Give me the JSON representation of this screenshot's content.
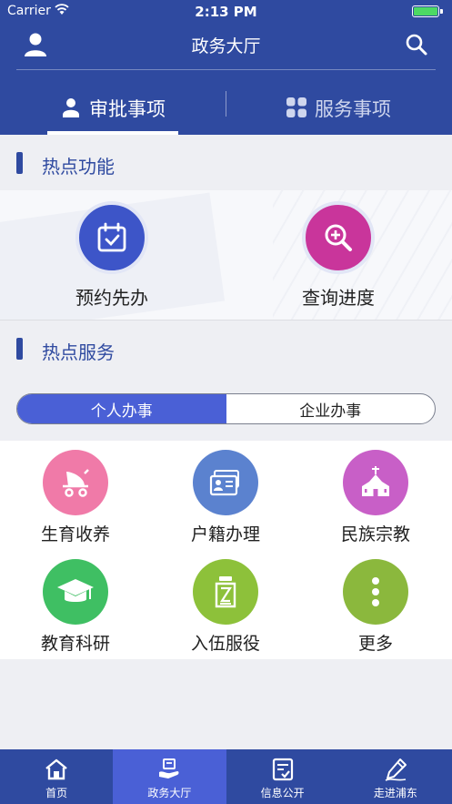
{
  "status_bar": {
    "carrier": "Carrier",
    "time": "2:13 PM"
  },
  "nav": {
    "title": "政务大厅"
  },
  "top_tabs": [
    {
      "label": "审批事项",
      "active": true
    },
    {
      "label": "服务事项",
      "active": false
    }
  ],
  "hot_functions": {
    "title": "热点功能",
    "items": [
      {
        "label": "预约先办",
        "icon": "calendar-check-icon",
        "color": "#3d55c8"
      },
      {
        "label": "查询进度",
        "icon": "magnify-plus-icon",
        "color": "#c9359b"
      }
    ]
  },
  "hot_services": {
    "title": "热点服务",
    "segments": [
      {
        "label": "个人办事",
        "active": true
      },
      {
        "label": "企业办事",
        "active": false
      }
    ],
    "items": [
      {
        "label": "生育收养",
        "icon": "stroller-icon",
        "color": "#f07aa8"
      },
      {
        "label": "户籍办理",
        "icon": "id-card-icon",
        "color": "#5b82cf"
      },
      {
        "label": "民族宗教",
        "icon": "church-icon",
        "color": "#c85fc7"
      },
      {
        "label": "教育科研",
        "icon": "graduation-cap-icon",
        "color": "#3fbf63"
      },
      {
        "label": "入伍服役",
        "icon": "soldier-icon",
        "color": "#8dc13a"
      },
      {
        "label": "更多",
        "icon": "more-dots-icon",
        "color": "#8bb83d"
      }
    ]
  },
  "tab_bar": [
    {
      "label": "首页",
      "icon": "home-icon",
      "active": false
    },
    {
      "label": "政务大厅",
      "icon": "hall-icon",
      "active": true
    },
    {
      "label": "信息公开",
      "icon": "document-check-icon",
      "active": false
    },
    {
      "label": "走进浦东",
      "icon": "pen-icon",
      "active": false
    }
  ],
  "colors": {
    "primary": "#2f4aa0",
    "accent": "#4a60d6",
    "background": "#eeeff3"
  }
}
